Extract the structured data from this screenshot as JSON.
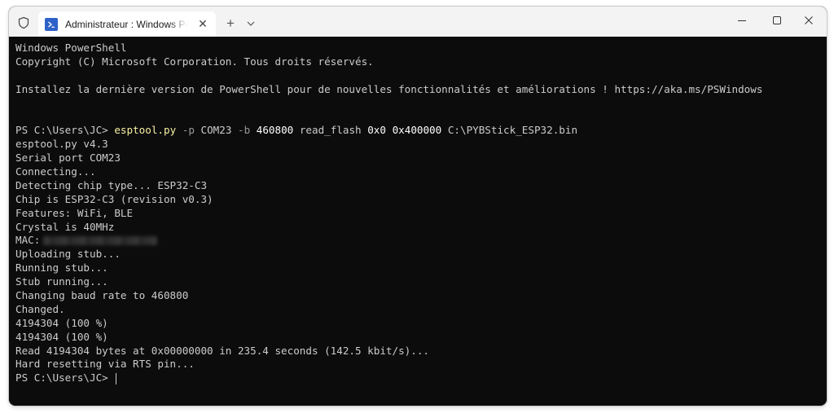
{
  "tab": {
    "title": "Administrateur : Windows PowerShell",
    "close_glyph": "✕"
  },
  "titlebar": {
    "new_tab_glyph": "+",
    "minimize_glyph": "—",
    "maximize_glyph": "▢",
    "close_glyph": "✕"
  },
  "icons": {
    "shield": "shield-icon",
    "tab": "powershell-icon",
    "dropdown": "chevron-down-icon"
  },
  "colors": {
    "terminal_bg": "#0c0c0c",
    "terminal_fg": "#cccccc",
    "command": "#f9f1a5",
    "parameter": "#9a9a9a",
    "titlebar_bg": "#f3f3f3",
    "tab_icon": "#2f62c9"
  },
  "terminal": {
    "header": [
      "Windows PowerShell",
      "Copyright (C) Microsoft Corporation. Tous droits réservés.",
      "",
      "Installez la dernière version de PowerShell pour de nouvelles fonctionnalités et améliorations ! https://aka.ms/PSWindows",
      "",
      ""
    ],
    "command": {
      "prompt": "PS C:\\Users\\JC> ",
      "exe": "esptool.py",
      "p_flag": " -p",
      "port": " COM23",
      "b_flag": " -b",
      "baud": " 460800",
      "action": " read_flash",
      "addr": " 0x0",
      "size": " 0x400000",
      "file": " C:\\PYBStick_ESP32.bin"
    },
    "output_before_mac": [
      "esptool.py v4.3",
      "Serial port COM23",
      "Connecting...",
      "Detecting chip type... ESP32-C3",
      "Chip is ESP32-C3 (revision v0.3)",
      "Features: WiFi, BLE",
      "Crystal is 40MHz"
    ],
    "mac_label": "MAC:",
    "output_after_mac": [
      "Uploading stub...",
      "Running stub...",
      "Stub running...",
      "Changing baud rate to 460800",
      "Changed.",
      "4194304 (100 %)",
      "4194304 (100 %)",
      "Read 4194304 bytes at 0x00000000 in 235.4 seconds (142.5 kbit/s)...",
      "Hard resetting via RTS pin..."
    ],
    "final_prompt": "PS C:\\Users\\JC> "
  }
}
